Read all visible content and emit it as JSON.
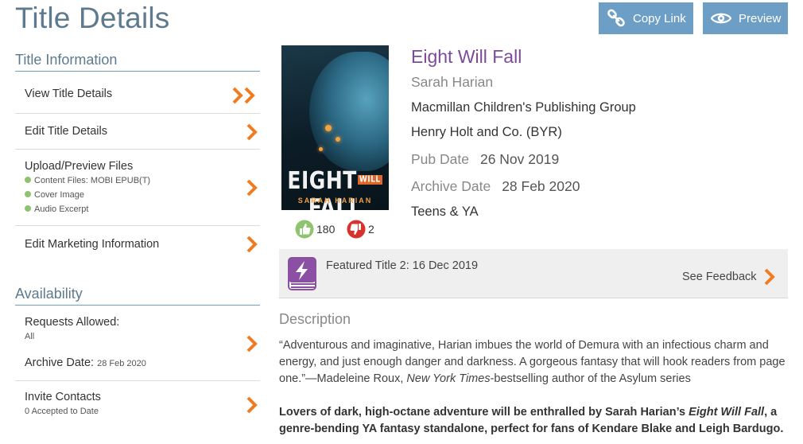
{
  "page": {
    "title": "Title Details"
  },
  "toolbar": {
    "copy_link_label": "Copy Link",
    "preview_label": "Preview"
  },
  "sidebar": {
    "title_info_heading": "Title Information",
    "items": {
      "view_details": "View Title Details",
      "edit_details": "Edit Title Details",
      "upload_files": "Upload/Preview Files",
      "content_files": "Content Files: MOBI EPUB(T)",
      "cover_image": "Cover Image",
      "audio_excerpt": "Audio Excerpt",
      "edit_marketing": "Edit Marketing Information"
    },
    "availability_heading": "Availability",
    "requests_label": "Requests Allowed:",
    "requests_value": "All",
    "archive_label": "Archive Date:",
    "archive_value": "28 Feb 2020",
    "invite_label": "Invite Contacts",
    "invite_sub": "0 Accepted to Date"
  },
  "book": {
    "title": "Eight Will Fall",
    "author": "Sarah Harian",
    "publisher": "Macmillan Children's Publishing Group",
    "imprint": "Henry Holt and Co. (BYR)",
    "pub_date_label": "Pub Date",
    "pub_date": "26 Nov 2019",
    "archive_date_label": "Archive Date",
    "archive_date": "28 Feb 2020",
    "category": "Teens & YA",
    "cover_word_1": "EIGHT",
    "cover_word_will": "WILL",
    "cover_word_2": "FALL",
    "cover_author": "SARAH HARIAN",
    "likes": "180",
    "dislikes": "2"
  },
  "featured": {
    "text": "Featured Title 2: 16 Dec 2019",
    "feedback_label": "See Feedback"
  },
  "description": {
    "heading": "Description",
    "p1_a": "“Adventurous and imaginative, Harian imbues the world of Demura with an infectious charm and energy, and just enough danger and darkness. A gorgeous fantasy that will hook readers from page one.”—Madeleine Roux, ",
    "p1_italic": "New York Times",
    "p1_b": "-bestselling author of the Asylum series",
    "p2_a": "Lovers of dark, high-octane adventure will be enthralled by Sarah Harian’s ",
    "p2_italic": "Eight Will Fall",
    "p2_b": ", a genre-bending YA fantasy standalone, perfect for fans of Kendare Blake and Leigh Bardugo."
  },
  "colors": {
    "accent_orange": "#f07c22",
    "accent_blue": "#6d9fc6",
    "title_purple": "#7b4a9a",
    "dot_green": "#8fc46f"
  },
  "icons": [
    "link-icon",
    "eye-icon",
    "double-chevron-icon",
    "chevron-right-icon",
    "thumbs-up-icon",
    "thumbs-down-icon",
    "featured-book-icon"
  ]
}
